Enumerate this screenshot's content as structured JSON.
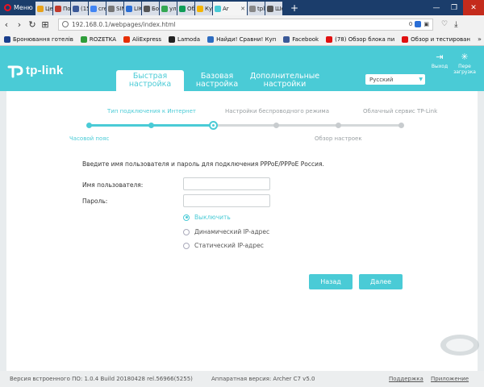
{
  "browser": {
    "menu_label": "Меню",
    "tabs": [
      {
        "label": "Цен",
        "color": "#e8a21a"
      },
      {
        "label": "Пос",
        "color": "#c0392b"
      },
      {
        "label": "(15",
        "color": "#3b5998"
      },
      {
        "label": "cre",
        "color": "#4285f4"
      },
      {
        "label": "SIN",
        "color": "#777777"
      },
      {
        "label": "LIK",
        "color": "#2a6ed6"
      },
      {
        "label": "Бое",
        "color": "#555555"
      },
      {
        "label": "ул.",
        "color": "#34a853"
      },
      {
        "label": "Обз",
        "color": "#0f9d58"
      },
      {
        "label": "Кур",
        "color": "#f4b400"
      },
      {
        "label": "Ar",
        "color": "#4acbd6",
        "active": true
      },
      {
        "label": "tpl",
        "color": "#888888"
      },
      {
        "label": "Ше",
        "color": "#555555"
      }
    ],
    "new_tab": "+",
    "address": "192.168.0.1/webpages/index.html",
    "vpn_count": "0",
    "bookmarks": [
      {
        "label": "Бронювання готелів",
        "color": "#1a3e8c"
      },
      {
        "label": "ROZETKA",
        "color": "#2e9d3a"
      },
      {
        "label": "AliExpress",
        "color": "#e62e04"
      },
      {
        "label": "Lamoda",
        "color": "#222222"
      },
      {
        "label": "Найди! Сравни! Куп",
        "color": "#2d6cc0"
      },
      {
        "label": "Facebook",
        "color": "#3b5998"
      },
      {
        "label": "(78) Обзор блока пи",
        "color": "#e01010"
      },
      {
        "label": "Обзор и тестирован",
        "color": "#e01010"
      }
    ],
    "bookmarks_more": "»"
  },
  "router": {
    "logo_text": "tp-link",
    "tabs": [
      {
        "line1": "Быстрая",
        "line2": "настройка",
        "active": true
      },
      {
        "line1": "Базовая",
        "line2": "настройка",
        "active": false
      },
      {
        "line1": "Дополнительные",
        "line2": "настройки",
        "active": false
      }
    ],
    "language": "Русский",
    "logout_label": "Выход",
    "reboot_line1": "Пере",
    "reboot_line2": "загрузка"
  },
  "wizard": {
    "steps_top": [
      "Тип подключения к Интернет",
      "Настройки беспроводного режима",
      "Облачный сервис TP-Link"
    ],
    "steps_bottom": [
      "Часовой пояс",
      "Обзор настроек"
    ],
    "instruction": "Введите имя пользователя и пароль для подключения PPPoE/PPPoE Россия.",
    "username_label": "Имя пользователя:",
    "password_label": "Пароль:",
    "username_value": "",
    "password_value": "",
    "options": [
      {
        "label": "Выключить",
        "selected": true
      },
      {
        "label": "Динамический IP-адрес",
        "selected": false
      },
      {
        "label": "Статический IP-адрес",
        "selected": false
      }
    ],
    "back_label": "Назад",
    "next_label": "Далее"
  },
  "footer": {
    "firmware": "Версия встроенного ПО: 1.0.4 Build 20180428 rel.56966(5255)",
    "hardware": "Аппаратная версия: Archer C7 v5.0",
    "support": "Поддержка",
    "app": "Приложение"
  },
  "colors": {
    "accent": "#4acbd6",
    "chrome": "#1b3d6b"
  }
}
